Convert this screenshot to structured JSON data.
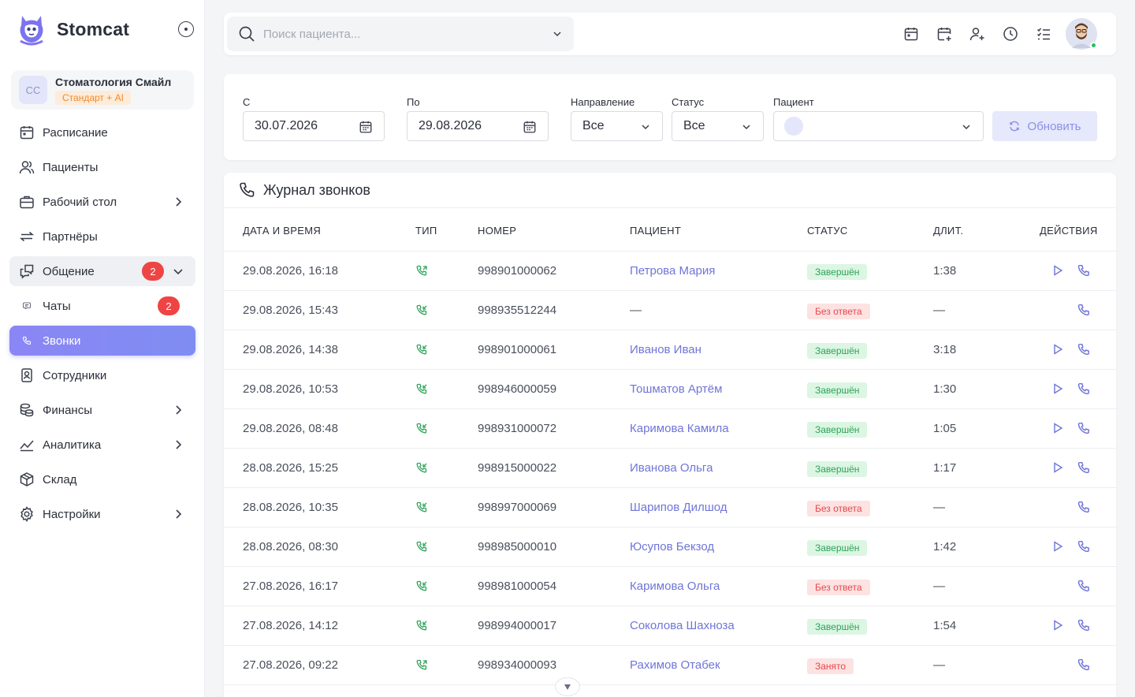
{
  "brand": {
    "name": "Stomcat"
  },
  "clinic": {
    "initials": "СС",
    "name": "Стоматология Смайл",
    "plan": "Стандарт + AI"
  },
  "nav": [
    {
      "label": "Расписание",
      "icon": "calendar-icon"
    },
    {
      "label": "Пациенты",
      "icon": "users-icon"
    },
    {
      "label": "Рабочий стол",
      "icon": "briefcase-icon",
      "expandable": true
    },
    {
      "label": "Партнёры",
      "icon": "swap-arrows-icon"
    },
    {
      "label": "Общение",
      "icon": "chat-bubbles-icon",
      "expanded": true,
      "badge": "2"
    },
    {
      "label": "Чаты",
      "icon": "chat-icon",
      "sub": true,
      "badge": "2"
    },
    {
      "label": "Звонки",
      "icon": "phone-icon",
      "sub": true,
      "active": true
    },
    {
      "label": "Сотрудники",
      "icon": "id-card-icon"
    },
    {
      "label": "Финансы",
      "icon": "coins-icon",
      "expandable": true
    },
    {
      "label": "Аналитика",
      "icon": "chart-line-icon",
      "expandable": true
    },
    {
      "label": "Склад",
      "icon": "box-icon"
    },
    {
      "label": "Настройки",
      "icon": "gear-icon",
      "expandable": true
    }
  ],
  "search": {
    "placeholder": "Поиск пациента..."
  },
  "filters": {
    "from_label": "С",
    "from_value": "30.07.2026",
    "to_label": "По",
    "to_value": "29.08.2026",
    "direction_label": "Направление",
    "direction_value": "Все",
    "status_label": "Статус",
    "status_value": "Все",
    "patient_label": "Пациент",
    "refresh_label": "Обновить"
  },
  "log": {
    "title": "Журнал звонков",
    "columns": [
      "ДАТА И ВРЕМЯ",
      "ТИП",
      "НОМЕР",
      "ПАЦИЕНТ",
      "СТАТУС",
      "ДЛИТ.",
      "ДЕЙСТВИЯ"
    ],
    "rows": [
      {
        "datetime": "29.08.2026, 16:18",
        "type": "outgoing",
        "number": "998901000062",
        "patient": "Петрова Мария",
        "status": "Завершён",
        "status_kind": "done",
        "duration": "1:38",
        "play": true
      },
      {
        "datetime": "29.08.2026, 15:43",
        "type": "incoming",
        "number": "998935512244",
        "patient": "—",
        "status": "Без ответа",
        "status_kind": "miss",
        "duration": "—",
        "play": false
      },
      {
        "datetime": "29.08.2026, 14:38",
        "type": "incoming",
        "number": "998901000061",
        "patient": "Иванов Иван",
        "status": "Завершён",
        "status_kind": "done",
        "duration": "3:18",
        "play": true
      },
      {
        "datetime": "29.08.2026, 10:53",
        "type": "incoming",
        "number": "998946000059",
        "patient": "Тошматов Артём",
        "status": "Завершён",
        "status_kind": "done",
        "duration": "1:30",
        "play": true
      },
      {
        "datetime": "29.08.2026, 08:48",
        "type": "incoming",
        "number": "998931000072",
        "patient": "Каримова Камила",
        "status": "Завершён",
        "status_kind": "done",
        "duration": "1:05",
        "play": true
      },
      {
        "datetime": "28.08.2026, 15:25",
        "type": "incoming",
        "number": "998915000022",
        "patient": "Иванова Ольга",
        "status": "Завершён",
        "status_kind": "done",
        "duration": "1:17",
        "play": true
      },
      {
        "datetime": "28.08.2026, 10:35",
        "type": "incoming",
        "number": "998997000069",
        "patient": "Шарипов Дилшод",
        "status": "Без ответа",
        "status_kind": "miss",
        "duration": "—",
        "play": false
      },
      {
        "datetime": "28.08.2026, 08:30",
        "type": "incoming",
        "number": "998985000010",
        "patient": "Юсупов Бекзод",
        "status": "Завершён",
        "status_kind": "done",
        "duration": "1:42",
        "play": true
      },
      {
        "datetime": "27.08.2026, 16:17",
        "type": "incoming",
        "number": "998981000054",
        "patient": "Каримова Ольга",
        "status": "Без ответа",
        "status_kind": "miss",
        "duration": "—",
        "play": false
      },
      {
        "datetime": "27.08.2026, 14:12",
        "type": "incoming",
        "number": "998994000017",
        "patient": "Соколова Шахноза",
        "status": "Завершён",
        "status_kind": "done",
        "duration": "1:54",
        "play": true
      },
      {
        "datetime": "27.08.2026, 09:22",
        "type": "outgoing",
        "number": "998934000093",
        "patient": "Рахимов Отабек",
        "status": "Занято",
        "status_kind": "miss",
        "duration": "—",
        "play": false
      }
    ]
  },
  "colors": {
    "accent": "#8b86f5",
    "link": "#6f75d8",
    "success": "#2ea35a",
    "danger": "#e5484d",
    "badge": "#ef4444",
    "plan": "#f08a2c"
  }
}
